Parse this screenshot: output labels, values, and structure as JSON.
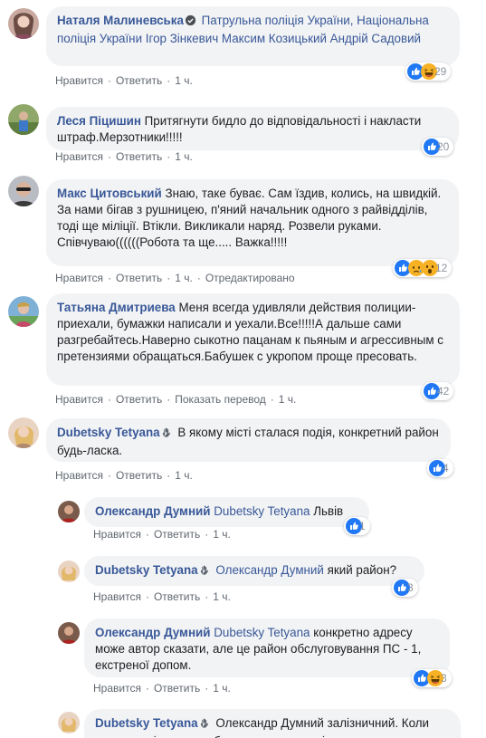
{
  "comments": [
    {
      "author": "Наталя Малиневська",
      "text": "Патрульна поліція України, Національна поліція України Ігор Зінкевич Максим Козицький Андрій Садовий",
      "actions": {
        "like": "Нравится",
        "reply": "Ответить",
        "time": "1 ч."
      },
      "reactions": {
        "count": "29",
        "icons": [
          "like-icon",
          "haha-icon"
        ]
      }
    },
    {
      "author": "Леся Піцишин",
      "text": "Притягнути бидло до відповідальності і накласти штраф.Мерзотники!!!!!",
      "actions": {
        "like": "Нравится",
        "reply": "Ответить",
        "time": "1 ч."
      },
      "reactions": {
        "count": "20",
        "icons": [
          "like-icon"
        ]
      }
    },
    {
      "author": "Макс Цитовський",
      "text_lines": [
        "Знаю, таке буває. Сам їздив, колись, на швидкій. За нами бігав з рушницею, п'яний начальник одного з райвідділів, тоді ще міліції. Втікли. Викликали наряд. Розвели руками.",
        "Співчуваю((((((Робота та ще..... Важка!!!!!"
      ],
      "actions": {
        "like": "Нравится",
        "reply": "Ответить",
        "time": "1 ч.",
        "edited": "Отредактировано"
      },
      "reactions": {
        "count": "12",
        "icons": [
          "like-icon",
          "sad-icon",
          "wow-icon"
        ]
      }
    },
    {
      "author": "Татьяна Дмитриева",
      "text": "Меня всегда удивляли действия полиции-приехали, бумажки написали и уехали.Все!!!!!А дальше сами разгребайтесь.Наверно сыкотно пацанам к пьяным и агрессивным с претензиями обращаться.Бабушек с укропом проще пресовать.",
      "actions": {
        "like": "Нравится",
        "reply": "Ответить",
        "translate": "Показать перевод",
        "time": "1 ч."
      },
      "reactions": {
        "count": "42",
        "icons": [
          "like-icon"
        ]
      }
    },
    {
      "author": "Dubetsky Tetyana",
      "text": "В якому місті сталася подія, конкретний район будь-ласка.",
      "actions": {
        "like": "Нравится",
        "reply": "Ответить",
        "time": "1 ч."
      },
      "reactions": {
        "count": "4",
        "icons": [
          "like-icon"
        ]
      }
    }
  ],
  "replies": [
    {
      "author": "Олександр Думний",
      "mention": "Dubetsky Tetyana",
      "text": "Львів",
      "actions": {
        "like": "Нравится",
        "reply": "Ответить",
        "time": "1 ч."
      },
      "reactions": {
        "count": "1",
        "icons": [
          "like-icon"
        ]
      }
    },
    {
      "author": "Dubetsky Tetyana",
      "mention": "Олександр Думний",
      "text": "який район?",
      "actions": {
        "like": "Нравится",
        "reply": "Ответить",
        "time": "1 ч."
      },
      "reactions": {
        "count": "3",
        "icons": [
          "like-icon"
        ]
      }
    },
    {
      "author": "Олександр Думний",
      "mention": "Dubetsky Tetyana",
      "text": "конкретно адресу може автор сказати, але це район обслуговування ПС - 1, екстреної допом.",
      "actions": {
        "like": "Нравится",
        "reply": "Ответить",
        "time": "1 ч."
      },
      "reactions": {
        "count": "3",
        "icons": [
          "like-icon",
          "haha-icon"
        ]
      }
    },
    {
      "author": "Dubetsky Tetyana",
      "mention": "Олександр Думний",
      "text": "залізничний. Коли винуть такі пости треба вказувати локацію, конкретно"
    }
  ],
  "colors": {
    "link": "#385898",
    "bubble": "#f2f3f5",
    "meta": "#606770",
    "like": "#2078f4",
    "haha": "#f7b125"
  }
}
